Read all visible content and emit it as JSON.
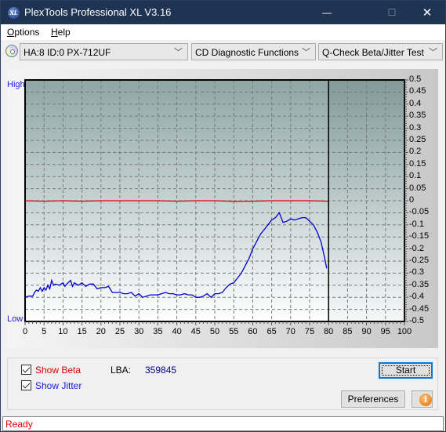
{
  "window": {
    "title": "PlexTools Professional XL V3.16",
    "app_icon_text": "XL",
    "minimize": "—",
    "maximize": "☐",
    "close": "✕"
  },
  "menu": {
    "items": [
      {
        "label": "Options",
        "mnemonic": "O"
      },
      {
        "label": "Help",
        "mnemonic": "H"
      }
    ]
  },
  "toolbar": {
    "drive_select": "HA:8 ID:0  PX-712UF",
    "function_select": "CD Diagnostic Functions",
    "test_select": "Q-Check Beta/Jitter Test",
    "chevron": "﹀"
  },
  "chart_data": {
    "type": "line",
    "title": "",
    "left_axis_labels": {
      "top": "High",
      "bottom": "Low"
    },
    "xlim": [
      0,
      100
    ],
    "ylim": [
      -0.5,
      0.5
    ],
    "x_ticks": [
      0,
      5,
      10,
      15,
      20,
      25,
      30,
      35,
      40,
      45,
      50,
      55,
      60,
      65,
      70,
      75,
      80,
      85,
      90,
      95,
      100
    ],
    "y_ticks": [
      "0.5",
      "0.45",
      "0.4",
      "0.35",
      "0.3",
      "0.25",
      "0.2",
      "0.15",
      "0.1",
      "0.05",
      "0",
      "-0.05",
      "-0.1",
      "-0.15",
      "-0.2",
      "-0.25",
      "-0.3",
      "-0.35",
      "-0.4",
      "-0.45",
      "-0.5"
    ],
    "y_tick_values": [
      0.5,
      0.45,
      0.4,
      0.35,
      0.3,
      0.25,
      0.2,
      0.15,
      0.1,
      0.05,
      0,
      -0.05,
      -0.1,
      -0.15,
      -0.2,
      -0.25,
      -0.3,
      -0.35,
      -0.4,
      -0.45,
      -0.5
    ],
    "grid": true,
    "progress_marker_x": 80,
    "series": [
      {
        "name": "Beta",
        "color": "#e00000",
        "x": [
          0,
          5,
          10,
          15,
          20,
          25,
          30,
          35,
          40,
          45,
          50,
          55,
          60,
          65,
          70,
          75,
          79.5,
          80
        ],
        "y": [
          0.0,
          -0.002,
          0.0,
          -0.002,
          0.0,
          0.0,
          0.0,
          0.0,
          -0.002,
          0.0,
          0.0,
          -0.003,
          -0.002,
          0.0,
          0.0,
          0.0,
          -0.002,
          -0.002
        ]
      },
      {
        "name": "Jitter",
        "color": "#0000d0",
        "x": [
          0,
          1,
          2,
          2.5,
          3,
          3.5,
          4,
          4.5,
          5,
          5.5,
          6,
          6.5,
          7,
          7.5,
          8,
          9,
          10,
          10.5,
          11,
          12,
          12.5,
          13,
          14,
          14.5,
          15,
          16,
          17,
          18,
          19,
          20,
          21,
          22,
          23,
          24,
          25,
          26,
          27,
          28,
          29,
          30,
          31,
          32,
          33,
          34,
          35,
          36,
          37,
          38,
          39,
          40,
          41,
          42,
          43,
          44,
          45,
          46,
          47,
          48,
          49,
          50,
          51,
          52,
          53,
          54,
          55,
          56,
          57,
          58,
          59,
          60,
          61,
          62,
          63,
          64,
          65,
          66,
          67,
          68,
          69,
          70,
          71,
          72,
          73,
          74,
          75,
          76,
          77,
          78,
          79,
          79.5
        ],
        "y": [
          -0.4,
          -0.395,
          -0.395,
          -0.38,
          -0.37,
          -0.375,
          -0.36,
          -0.375,
          -0.36,
          -0.37,
          -0.35,
          -0.365,
          -0.33,
          -0.35,
          -0.345,
          -0.35,
          -0.34,
          -0.355,
          -0.345,
          -0.33,
          -0.355,
          -0.34,
          -0.35,
          -0.345,
          -0.34,
          -0.355,
          -0.345,
          -0.345,
          -0.365,
          -0.36,
          -0.36,
          -0.355,
          -0.38,
          -0.38,
          -0.38,
          -0.385,
          -0.385,
          -0.38,
          -0.395,
          -0.385,
          -0.4,
          -0.395,
          -0.39,
          -0.39,
          -0.39,
          -0.385,
          -0.38,
          -0.385,
          -0.385,
          -0.39,
          -0.39,
          -0.385,
          -0.39,
          -0.39,
          -0.4,
          -0.4,
          -0.395,
          -0.385,
          -0.4,
          -0.385,
          -0.385,
          -0.38,
          -0.36,
          -0.345,
          -0.34,
          -0.32,
          -0.3,
          -0.27,
          -0.24,
          -0.2,
          -0.17,
          -0.14,
          -0.12,
          -0.1,
          -0.08,
          -0.07,
          -0.05,
          -0.09,
          -0.085,
          -0.075,
          -0.08,
          -0.075,
          -0.07,
          -0.07,
          -0.085,
          -0.1,
          -0.13,
          -0.17,
          -0.24,
          -0.28
        ]
      }
    ]
  },
  "controls": {
    "show_beta": {
      "label": "Show Beta",
      "checked": true,
      "color": "#e00000"
    },
    "show_jitter": {
      "label": "Show Jitter",
      "checked": true,
      "color": "#1a1ad8"
    },
    "lba_label": "LBA:",
    "lba_value": "359845",
    "start_button": "Start",
    "preferences_button": "Preferences",
    "info_icon_text": "i"
  },
  "status": {
    "text": "Ready"
  }
}
